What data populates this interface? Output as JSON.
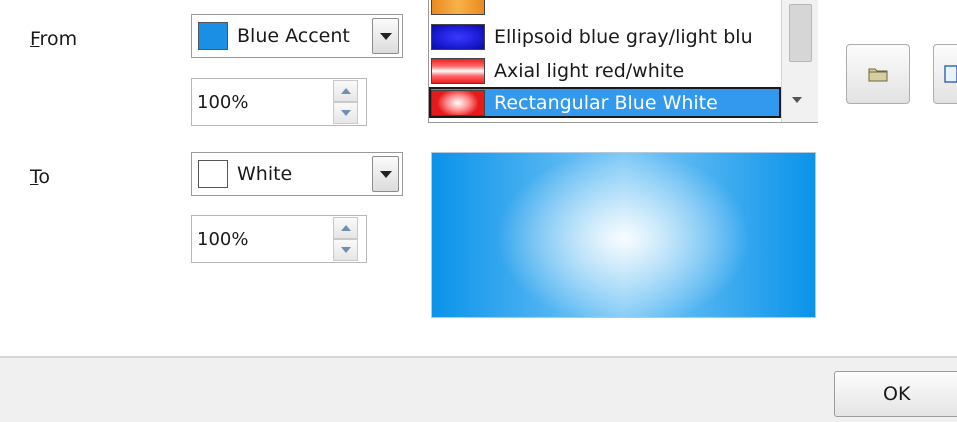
{
  "from": {
    "label_accel": "F",
    "label_rest": "rom",
    "color_name": "Blue Accent",
    "swatch_color": "#1a8fe3",
    "intensity": "100%"
  },
  "to": {
    "label_accel": "T",
    "label_rest": "o",
    "color_name": "White",
    "swatch_color": "#ffffff",
    "intensity": "100%"
  },
  "gradient_list": {
    "items": [
      {
        "label": "Ellipsoid blue gray/light blu",
        "selected": false
      },
      {
        "label": "Axial light red/white",
        "selected": false
      },
      {
        "label": "Rectangular Blue White",
        "selected": true
      }
    ]
  },
  "toolbar": {
    "load_icon": "folder-icon",
    "save_icon": "save-icon"
  },
  "footer": {
    "ok_label": "OK"
  },
  "colors": {
    "selection": "#3399ee",
    "preview_edge": "#0a93ea",
    "preview_center": "#ffffff"
  }
}
